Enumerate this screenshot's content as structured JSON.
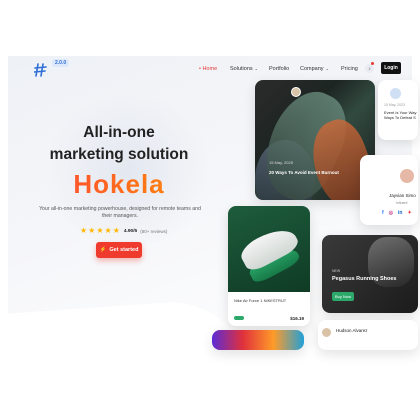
{
  "brand": {
    "version": "2.0.0",
    "accent": "#ef3b2d"
  },
  "nav": {
    "items": [
      {
        "label": "• Home",
        "active": true
      },
      {
        "label": "Solutions",
        "dropdown": true
      },
      {
        "label": "Portfolio",
        "dropdown": false
      },
      {
        "label": "Company",
        "dropdown": true
      },
      {
        "label": "Pricing",
        "dropdown": false
      }
    ],
    "notification_icon": "bell-icon",
    "login_label": "Login"
  },
  "hero": {
    "title_line1": "All-in-one",
    "title_line2": "marketing solution",
    "brand_name": "Hokela",
    "subtitle": "Your all-in-one marketing powerhouse, designed for remote teams and their managers.",
    "rating": {
      "stars": 5,
      "score": "4.90/5",
      "reviews": "(80+ reviews)"
    },
    "cta_label": "Get started",
    "cta_icon": "bolt-icon"
  },
  "cards": {
    "article": {
      "date": "15 May, 2025",
      "title": "20 Ways To Avoid Event Burnout"
    },
    "mini_article": {
      "date": "15 May, 2023",
      "title": "Event Is Your Way Ways To Defeat S"
    },
    "product": {
      "title": "Nike Air Force 1 NIKESTRUT",
      "price": "$16.19"
    },
    "profile": {
      "name": "Jayvian Simo",
      "role": "Influent",
      "socials": [
        "f",
        "◎",
        "in",
        "✦"
      ]
    },
    "promo": {
      "badge": "NEW",
      "title": "Pegasus Running Shoes",
      "button_label": "Buy Now"
    },
    "person": {
      "name": "Hudson Alvarez"
    }
  }
}
